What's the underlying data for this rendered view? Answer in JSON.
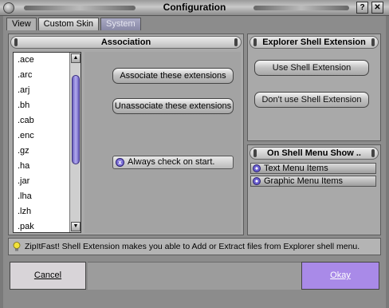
{
  "window": {
    "title": "Configuration",
    "help_label": "?",
    "close_label": "✕"
  },
  "tabs": [
    {
      "label": "View"
    },
    {
      "label": "Custom Skin"
    },
    {
      "label": "System"
    }
  ],
  "association": {
    "header": "Association",
    "extensions": [
      ".ace",
      ".arc",
      ".arj",
      ".bh",
      ".cab",
      ".enc",
      ".gz",
      ".ha",
      ".jar",
      ".lha",
      ".lzh",
      ".pak"
    ],
    "associate_label": "Associate these extensions",
    "unassociate_label": "Unassociate these extensions",
    "always_check_label": "Always check on start."
  },
  "shell_extension": {
    "header": "Explorer Shell Extension",
    "use_label": "Use Shell Extension",
    "dont_use_label": "Don't use Shell Extension"
  },
  "shell_menu": {
    "header": "On Shell Menu Show ..",
    "options": [
      {
        "label": "Text Menu Items"
      },
      {
        "label": "Graphic Menu Items"
      }
    ]
  },
  "info": {
    "text": "ZipItFast! Shell Extension makes you able to Add or Extract files from Explorer shell menu."
  },
  "footer": {
    "cancel_label": "Cancel",
    "okay_label": "Okay"
  }
}
